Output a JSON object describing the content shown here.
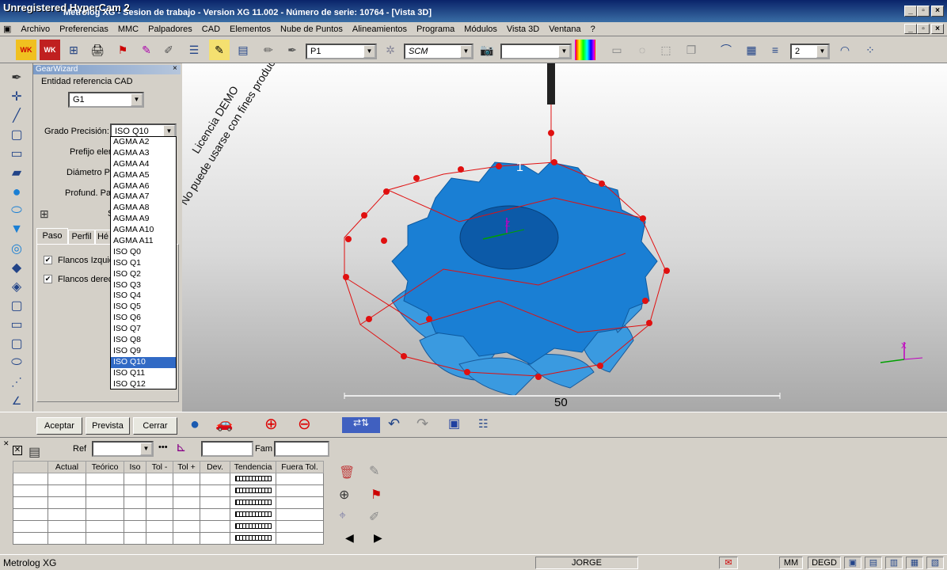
{
  "watermark": "Unregistered HyperCam 2",
  "window_title": "Metrolog XG - Sesion de trabajo - Version XG 11.002 - Número de serie: 10764 - [Vista 3D]",
  "menu": [
    "Archivo",
    "Preferencias",
    "MMC",
    "Palpadores",
    "CAD",
    "Elementos",
    "Nube de Puntos",
    "Alineamientos",
    "Programa",
    "Módulos",
    "Vista 3D",
    "Ventana",
    "?"
  ],
  "toolbar": {
    "probe_value": "P1",
    "system_value": "SCM",
    "blank_value": "",
    "count_value": "2"
  },
  "panel": {
    "title": "GearWizard",
    "cad_label": "Entidad referencia CAD",
    "cad_value": "G1",
    "precision_label": "Grado Precisión:",
    "precision_value": "ISO Q10",
    "prefix_label": "Prefijo elem",
    "diameter_label": "Diámetro Pal",
    "depth_label": "Profund. Palp",
    "s_label": "S",
    "tabs": [
      "Paso",
      "Perfil",
      "Hé"
    ],
    "check_left": "Flancos Izquie",
    "check_right": "Flancos derech"
  },
  "precision_options": [
    "AGMA A2",
    "AGMA A3",
    "AGMA A4",
    "AGMA A5",
    "AGMA A6",
    "AGMA A7",
    "AGMA A8",
    "AGMA A9",
    "AGMA A10",
    "AGMA A11",
    "ISO Q0",
    "ISO Q1",
    "ISO Q2",
    "ISO Q3",
    "ISO Q4",
    "ISO Q5",
    "ISO Q6",
    "ISO Q7",
    "ISO Q8",
    "ISO Q9",
    "ISO Q10",
    "ISO Q11",
    "ISO Q12"
  ],
  "selected_option": "ISO Q10",
  "view": {
    "demo_line1": "Licencia DEMO",
    "demo_line2": "No puede usarse con fines productivos",
    "gear_label": "1",
    "scale_label": "50",
    "axis_z": "Z",
    "axis_x": "X"
  },
  "buttons": {
    "accept": "Aceptar",
    "preview": "Prevista",
    "close": "Cerrar"
  },
  "results": {
    "ref_label": "Ref",
    "fam_label": "Fam",
    "columns": [
      "",
      "Actual",
      "Teórico",
      "Iso",
      "Tol -",
      "Tol +",
      "Dev.",
      "Tendencia",
      "Fuera Tol."
    ],
    "row_count": 6
  },
  "status": {
    "app": "Metrolog XG",
    "user": "JORGE",
    "units": "MM",
    "angle": "DEGD"
  },
  "colors": {
    "gear": "#1a7fd4",
    "probe_points": "#e01010",
    "selection": "#316ac5"
  }
}
